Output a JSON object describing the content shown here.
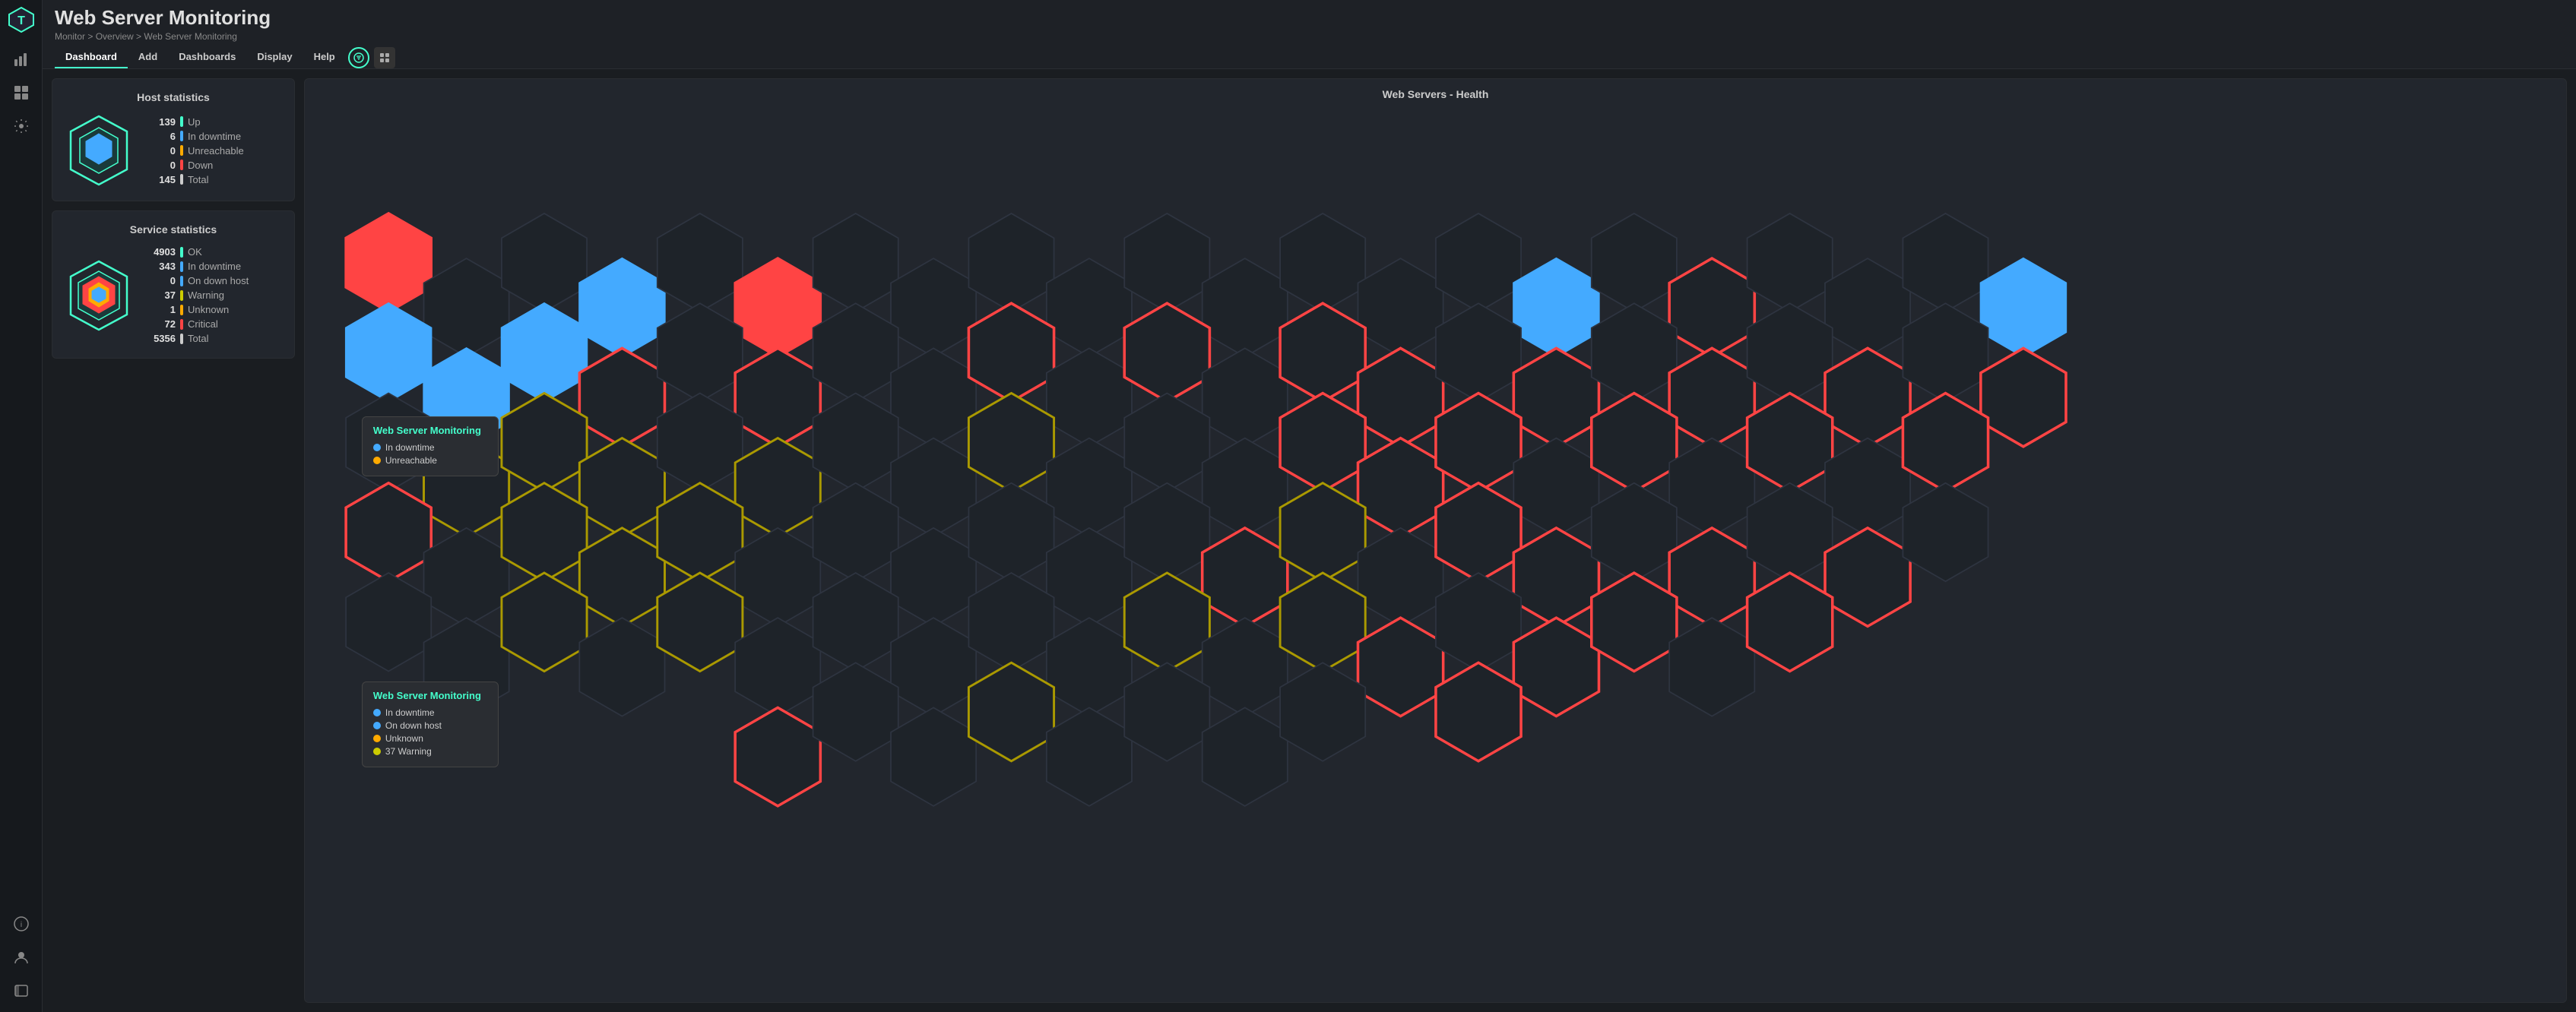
{
  "app": {
    "logo_color": "#4fc",
    "title": "Web Server Monitoring",
    "breadcrumb": "Monitor > Overview > Web Server Monitoring"
  },
  "nav": {
    "items": [
      {
        "label": "Dashboard",
        "active": true
      },
      {
        "label": "Add",
        "active": false
      },
      {
        "label": "Dashboards",
        "active": false
      },
      {
        "label": "Display",
        "active": false
      },
      {
        "label": "Help",
        "active": false
      }
    ]
  },
  "host_statistics": {
    "title": "Host statistics",
    "rows": [
      {
        "num": "139",
        "label": "Up",
        "color": "green"
      },
      {
        "num": "6",
        "label": "In downtime",
        "color": "blue"
      },
      {
        "num": "0",
        "label": "Unreachable",
        "color": "orange"
      },
      {
        "num": "0",
        "label": "Down",
        "color": "red"
      },
      {
        "num": "145",
        "label": "Total",
        "color": "white"
      }
    ]
  },
  "service_statistics": {
    "title": "Service statistics",
    "rows": [
      {
        "num": "4903",
        "label": "OK",
        "color": "green"
      },
      {
        "num": "343",
        "label": "In downtime",
        "color": "blue"
      },
      {
        "num": "0",
        "label": "On down host",
        "color": "blue"
      },
      {
        "num": "37",
        "label": "Warning",
        "color": "yellow"
      },
      {
        "num": "1",
        "label": "Unknown",
        "color": "orange"
      },
      {
        "num": "72",
        "label": "Critical",
        "color": "red"
      },
      {
        "num": "5356",
        "label": "Total",
        "color": "white"
      }
    ]
  },
  "hex_grid": {
    "title": "Web Servers - Health"
  },
  "tooltip1": {
    "title": "Web Server Monitoring",
    "rows": [
      {
        "label": "In downtime",
        "color": "#4af"
      },
      {
        "label": "Unreachable",
        "color": "#fa0"
      }
    ]
  },
  "tooltip2": {
    "title": "Web Server Monitoring",
    "rows": [
      {
        "label": "In downtime",
        "color": "#4af"
      },
      {
        "label": "On down host",
        "color": "#4af"
      },
      {
        "label": "Unknown",
        "color": "#fa0"
      },
      {
        "label": "37 Warning",
        "color": "#cc0"
      }
    ]
  },
  "colors": {
    "accent": "#4fc",
    "bg_dark": "#1a1d21",
    "bg_card": "#22262d",
    "red": "#f44",
    "blue": "#4af",
    "green": "#4fc",
    "orange": "#fa0",
    "yellow": "#cc0",
    "white": "#ccc"
  }
}
